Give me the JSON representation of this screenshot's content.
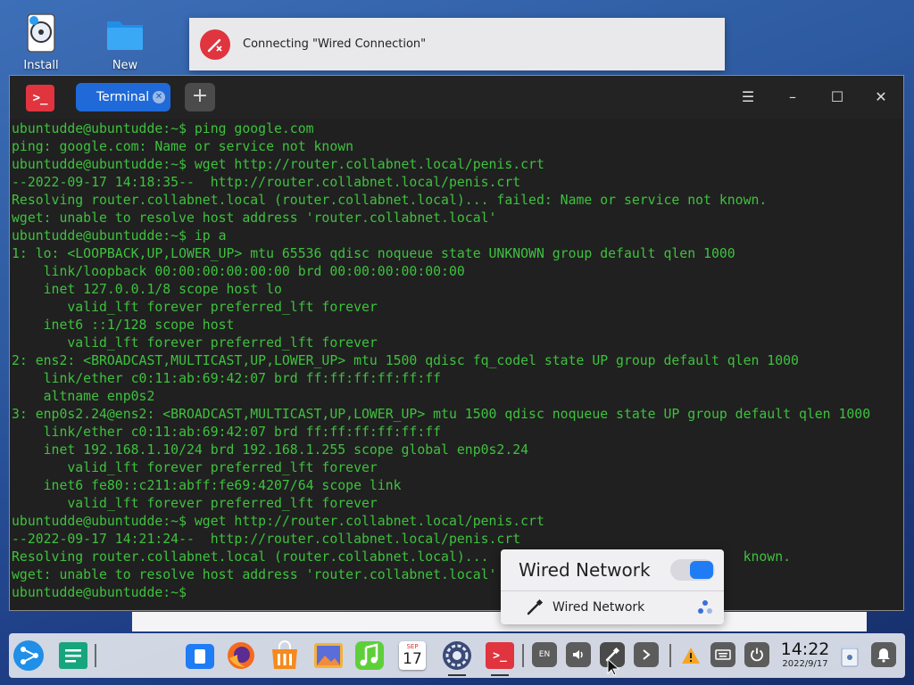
{
  "desktop": {
    "icons": [
      {
        "label": "Install"
      },
      {
        "label": "New"
      }
    ]
  },
  "notification": {
    "text": "Connecting \"Wired Connection\""
  },
  "terminal": {
    "tab_label": "Terminal",
    "new_tab_symbol": "+",
    "menu_symbol": "☰",
    "minimize_symbol": "–",
    "maximize_symbol": "☐",
    "close_symbol": "✕",
    "prompt_icon": ">_",
    "lines": [
      "ubuntudde@ubuntudde:~$ ping google.com",
      "ping: google.com: Name or service not known",
      "ubuntudde@ubuntudde:~$ wget http://router.collabnet.local/penis.crt",
      "--2022-09-17 14:18:35--  http://router.collabnet.local/penis.crt",
      "Resolving router.collabnet.local (router.collabnet.local)... failed: Name or service not known.",
      "wget: unable to resolve host address 'router.collabnet.local'",
      "ubuntudde@ubuntudde:~$ ip a",
      "1: lo: <LOOPBACK,UP,LOWER_UP> mtu 65536 qdisc noqueue state UNKNOWN group default qlen 1000",
      "    link/loopback 00:00:00:00:00:00 brd 00:00:00:00:00:00",
      "    inet 127.0.0.1/8 scope host lo",
      "       valid_lft forever preferred_lft forever",
      "    inet6 ::1/128 scope host",
      "       valid_lft forever preferred_lft forever",
      "2: ens2: <BROADCAST,MULTICAST,UP,LOWER_UP> mtu 1500 qdisc fq_codel state UP group default qlen 1000",
      "    link/ether c0:11:ab:69:42:07 brd ff:ff:ff:ff:ff:ff",
      "    altname enp0s2",
      "3: enp0s2.24@ens2: <BROADCAST,MULTICAST,UP,LOWER_UP> mtu 1500 qdisc noqueue state UP group default qlen 1000",
      "    link/ether c0:11:ab:69:42:07 brd ff:ff:ff:ff:ff:ff",
      "    inet 192.168.1.10/24 brd 192.168.1.255 scope global enp0s2.24",
      "       valid_lft forever preferred_lft forever",
      "    inet6 fe80::c211:abff:fe69:4207/64 scope link",
      "       valid_lft forever preferred_lft forever",
      "ubuntudde@ubuntudde:~$ wget http://router.collabnet.local/penis.crt",
      "--2022-09-17 14:21:24--  http://router.collabnet.local/penis.crt",
      "Resolving router.collabnet.local (router.collabnet.local)...                                known.",
      "wget: unable to resolve host address 'router.collabnet.local'",
      "ubuntudde@ubuntudde:~$ "
    ]
  },
  "network_popup": {
    "title": "Wired Network",
    "toggle_on": true,
    "item_label": "Wired Network"
  },
  "taskbar": {
    "calendar": {
      "month": "SEP",
      "day": "17"
    },
    "keyboard_layout": "EN",
    "clock": {
      "time": "14:22",
      "date": "2022/9/17"
    }
  },
  "colors": {
    "terminal_text": "#3ec13e",
    "accent": "#1f7cf5",
    "notification_icon": "#e0343f"
  }
}
